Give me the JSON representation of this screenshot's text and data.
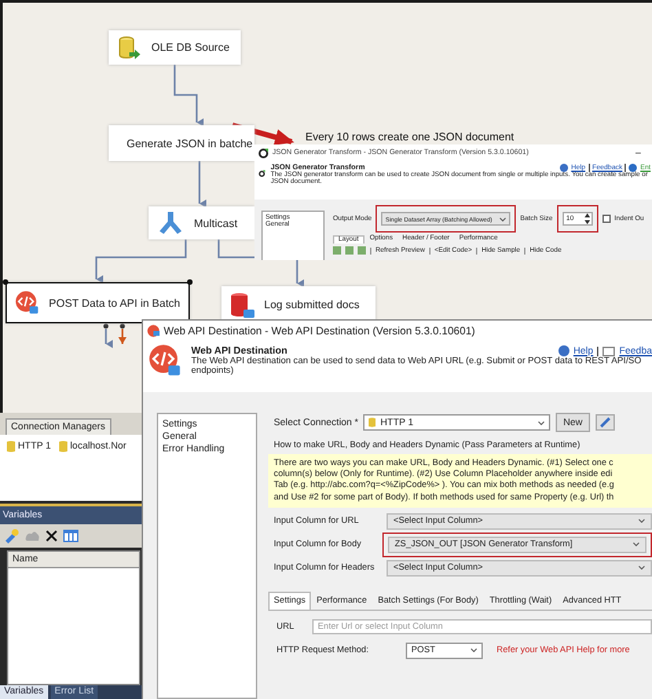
{
  "flow": {
    "nodes": [
      {
        "label": "OLE DB Source",
        "kind": "source",
        "selected": false
      },
      {
        "label": "Generate JSON in batche",
        "kind": "transform",
        "selected": false
      },
      {
        "label": "Multicast",
        "kind": "multicast",
        "selected": false
      },
      {
        "label": "POST Data to API in Batch",
        "kind": "destination",
        "selected": true
      },
      {
        "label": "Log submitted docs",
        "kind": "log",
        "selected": false
      }
    ],
    "annotation": "Every 10 rows create one JSON document"
  },
  "connection_managers": {
    "title": "Connection Managers",
    "items": [
      "HTTP 1",
      "localhost.Nor"
    ]
  },
  "variables": {
    "title": "Variables",
    "column": "Name"
  },
  "bottom_tabs": [
    {
      "label": "Variables",
      "selected": true
    },
    {
      "label": "Error List",
      "selected": false
    }
  ],
  "json_window": {
    "title": "JSON Generator Transform - JSON Generator Transform (Version 5.3.0.10601)",
    "minimize": "–",
    "heading": "JSON Generator Transform",
    "description": [
      "The JSON generator transform can be used to create JSON document from single or multiple inputs. You can create sample or",
      "JSON document."
    ],
    "links": [
      "Help",
      "Feedback",
      "Ent"
    ],
    "nav": [
      "Settings",
      "General"
    ],
    "output_mode_label": "Output Mode",
    "output_mode": "Single Dataset Array (Batching Allowed)",
    "batch_size_label": "Batch Size",
    "batch_size": "10",
    "indent": {
      "label": "Indent Ou",
      "checked": false
    },
    "tabs": [
      {
        "label": "Layout",
        "selected": true
      },
      {
        "label": "Options",
        "selected": false
      },
      {
        "label": "Header / Footer",
        "selected": false
      },
      {
        "label": "Performance",
        "selected": false
      }
    ],
    "toolbar": [
      "Refresh Preview",
      "<Edit Code>",
      "Hide Sample",
      "Hide Code"
    ]
  },
  "web_api_window": {
    "title": "Web API Destination - Web API Destination (Version 5.3.0.10601)",
    "heading": "Web API Destination",
    "description": [
      "The Web API destination can be used to send data to Web API URL (e.g. Submit or POST data to REST API/SO",
      "endpoints)"
    ],
    "links": [
      "Help",
      "Feedba"
    ],
    "nav": [
      "Settings",
      "General",
      "Error Handling"
    ],
    "connection_label": "Select Connection *",
    "connection": "HTTP 1",
    "new_button": "New",
    "dynamic_title": "How to make URL, Body and Headers Dynamic (Pass Parameters at Runtime)",
    "info": [
      "There are two ways you can make URL, Body and Headers Dynamic. (#1) Select one c",
      "column(s) below (Only for Runtime). (#2) Use Column Placeholder anywhere inside edi",
      "Tab (e.g. http://abc.com?q=<%ZipCode%> ). You can mix both methods as needed (e.g",
      "and Use #2 for some part of Body). If both methods used for same Property (e.g. Url) th"
    ],
    "input_columns": [
      {
        "label": "Input Column for URL",
        "value": "<Select Input Column>"
      },
      {
        "label": "Input Column for Body",
        "value": "ZS_JSON_OUT [JSON Generator Transform]"
      },
      {
        "label": "Input Column for Headers",
        "value": "<Select Input Column>"
      }
    ],
    "tabs": [
      {
        "label": "Settings",
        "selected": true
      },
      {
        "label": "Performance",
        "selected": false
      },
      {
        "label": "Batch Settings (For Body)",
        "selected": false
      },
      {
        "label": "Throttling (Wait)",
        "selected": false
      },
      {
        "label": "Advanced HTT",
        "selected": false
      }
    ],
    "url_label": "URL",
    "url_placeholder": "Enter Url or select Input Column",
    "method_label": "HTTP Request Method:",
    "method": "POST",
    "method_hint": "Refer your Web API Help for more"
  }
}
